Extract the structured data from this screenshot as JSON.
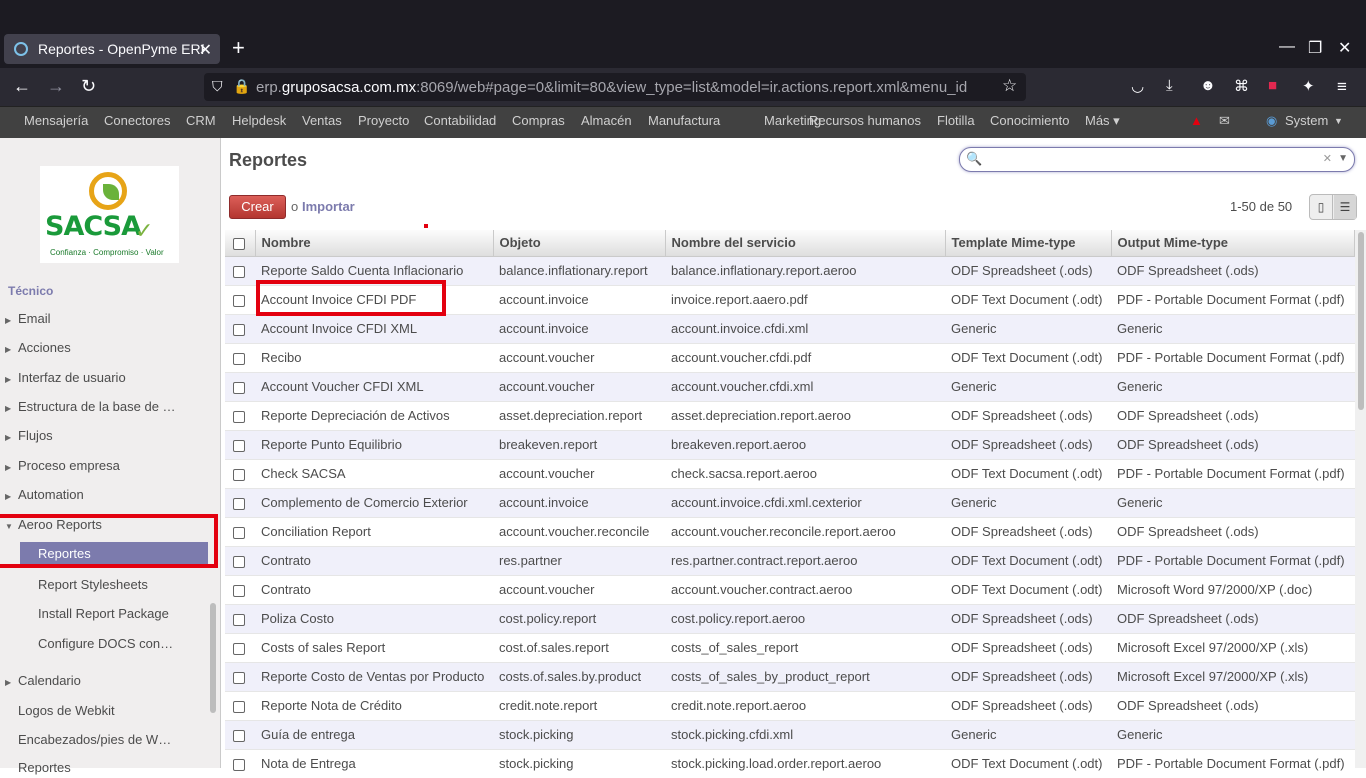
{
  "browser": {
    "tab_title": "Reportes - OpenPyme ERP",
    "tab_close": "✕",
    "new_tab": "+",
    "url_host_prefix": "erp.",
    "url_host": "gruposacsa.com.mx",
    "url_rest": ":8069/web#page=0&limit=80&view_type=list&model=ir.actions.report.xml&menu_id",
    "window_controls": [
      "—",
      "❐",
      "✕"
    ]
  },
  "menu": {
    "items": [
      "Mensajería",
      "Conectores",
      "CRM",
      "Helpdesk",
      "Ventas",
      "Proyecto",
      "Contabilidad",
      "Compras",
      "Almacén",
      "Manufactura",
      "Marketing",
      "Recursos humanos",
      "Flotilla",
      "Conocimiento",
      "Más ▾"
    ],
    "user": "System"
  },
  "sidebar": {
    "logo_text": "SACSA",
    "logo_tagline": "Confianza · Compromiso · Valor",
    "section_partial": "Técnico",
    "items": [
      {
        "label": "Email"
      },
      {
        "label": "Acciones"
      },
      {
        "label": "Interfaz de usuario"
      },
      {
        "label": "Estructura de la base de …"
      },
      {
        "label": "Flujos"
      },
      {
        "label": "Proceso empresa"
      },
      {
        "label": "Automation"
      },
      {
        "label": "Aeroo Reports"
      }
    ],
    "aeroo_children": [
      "Reportes",
      "Report Stylesheets",
      "Install Report Package",
      "Configure DOCS con…"
    ],
    "bottom_items": [
      "Calendario",
      "Logos de Webkit",
      "Encabezados/pies de W…",
      "Reportes"
    ]
  },
  "main": {
    "title": "Reportes",
    "create_label": "Crear",
    "or_label": "o",
    "import_label": "Importar",
    "pager": "1-50 de 50",
    "columns": [
      "Nombre",
      "Objeto",
      "Nombre del servicio",
      "Template Mime-type",
      "Output Mime-type"
    ],
    "rows": [
      [
        "Reporte Saldo Cuenta Inflacionario",
        "balance.inflationary.report",
        "balance.inflationary.report.aeroo",
        "ODF Spreadsheet (.ods)",
        "ODF Spreadsheet (.ods)"
      ],
      [
        "Account Invoice CFDI PDF",
        "account.invoice",
        "invoice.report.aaero.pdf",
        "ODF Text Document (.odt)",
        "PDF - Portable Document Format (.pdf)"
      ],
      [
        "Account Invoice CFDI XML",
        "account.invoice",
        "account.invoice.cfdi.xml",
        "Generic",
        "Generic"
      ],
      [
        "Recibo",
        "account.voucher",
        "account.voucher.cfdi.pdf",
        "ODF Text Document (.odt)",
        "PDF - Portable Document Format (.pdf)"
      ],
      [
        "Account Voucher CFDI XML",
        "account.voucher",
        "account.voucher.cfdi.xml",
        "Generic",
        "Generic"
      ],
      [
        "Reporte Depreciación de Activos",
        "asset.depreciation.report",
        "asset.depreciation.report.aeroo",
        "ODF Spreadsheet (.ods)",
        "ODF Spreadsheet (.ods)"
      ],
      [
        "Reporte Punto Equilibrio",
        "breakeven.report",
        "breakeven.report.aeroo",
        "ODF Spreadsheet (.ods)",
        "ODF Spreadsheet (.ods)"
      ],
      [
        "Check SACSA",
        "account.voucher",
        "check.sacsa.report.aeroo",
        "ODF Text Document (.odt)",
        "PDF - Portable Document Format (.pdf)"
      ],
      [
        "Complemento de Comercio Exterior",
        "account.invoice",
        "account.invoice.cfdi.xml.cexterior",
        "Generic",
        "Generic"
      ],
      [
        "Conciliation Report",
        "account.voucher.reconcile",
        "account.voucher.reconcile.report.aeroo",
        "ODF Spreadsheet (.ods)",
        "ODF Spreadsheet (.ods)"
      ],
      [
        "Contrato",
        "res.partner",
        "res.partner.contract.report.aeroo",
        "ODF Text Document (.odt)",
        "PDF - Portable Document Format (.pdf)"
      ],
      [
        "Contrato",
        "account.voucher",
        "account.voucher.contract.aeroo",
        "ODF Text Document (.odt)",
        "Microsoft Word 97/2000/XP (.doc)"
      ],
      [
        "Poliza Costo",
        "cost.policy.report",
        "cost.policy.report.aeroo",
        "ODF Spreadsheet (.ods)",
        "ODF Spreadsheet (.ods)"
      ],
      [
        "Costs of sales Report",
        "cost.of.sales.report",
        "costs_of_sales_report",
        "ODF Spreadsheet (.ods)",
        "Microsoft Excel 97/2000/XP (.xls)"
      ],
      [
        "Reporte Costo de Ventas por Producto",
        "costs.of.sales.by.product",
        "costs_of_sales_by_product_report",
        "ODF Spreadsheet (.ods)",
        "Microsoft Excel 97/2000/XP (.xls)"
      ],
      [
        "Reporte Nota de Crédito",
        "credit.note.report",
        "credit.note.report.aeroo",
        "ODF Spreadsheet (.ods)",
        "ODF Spreadsheet (.ods)"
      ],
      [
        "Guía de entrega",
        "stock.picking",
        "stock.picking.cfdi.xml",
        "Generic",
        "Generic"
      ],
      [
        "Nota de Entrega",
        "stock.picking",
        "stock.picking.load.order.report.aeroo",
        "ODF Text Document (.odt)",
        "PDF - Portable Document Format (.pdf)"
      ]
    ]
  },
  "colors": {
    "accent": "#7c7bad",
    "create": "#dc3535",
    "highlight": "#e3000f",
    "menu_bg": "#414141"
  }
}
